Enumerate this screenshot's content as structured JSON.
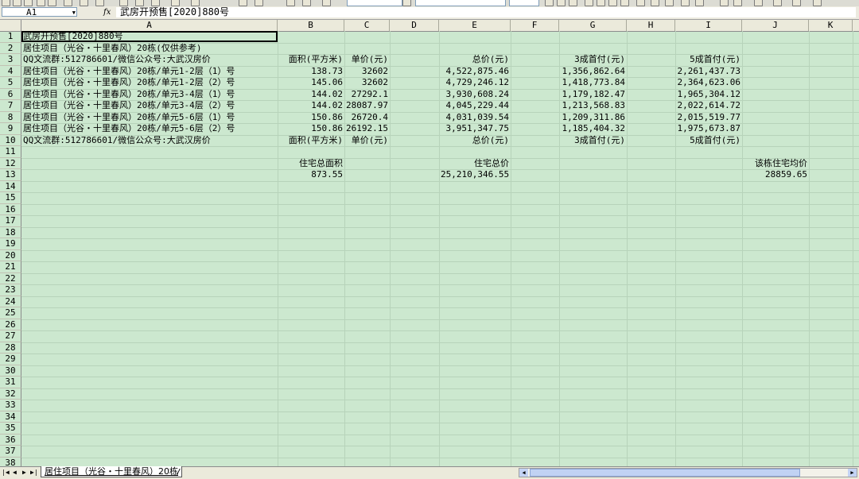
{
  "formula_bar": {
    "name_box": "A1",
    "fx_label": "fx",
    "formula": "武房开预售[2020]880号"
  },
  "columns": [
    "A",
    "B",
    "C",
    "D",
    "E",
    "F",
    "G",
    "H",
    "I",
    "J",
    "K"
  ],
  "rows": [
    "1",
    "2",
    "3",
    "4",
    "5",
    "6",
    "7",
    "8",
    "9",
    "10",
    "11",
    "12",
    "13",
    "14",
    "15",
    "16",
    "17",
    "18",
    "19",
    "20",
    "21",
    "22",
    "23",
    "24",
    "25",
    "26",
    "27",
    "28",
    "29",
    "30",
    "31",
    "32",
    "33",
    "34",
    "35",
    "36",
    "37",
    "38"
  ],
  "cells": {
    "r1": {
      "a": "武房开预售[2020]880号"
    },
    "r2": {
      "a": "居住项目（光谷・十里春风）20栋(仅供参考)"
    },
    "r3": {
      "a": "QQ文流群:512786601/微信公众号:大武汉房价",
      "b": "面积(平方米)",
      "c": "单价(元)",
      "e": "总价(元)",
      "g": "3成首付(元)",
      "i": "5成首付(元)"
    },
    "r4": {
      "a": "居住项目（光谷・十里春风）20栋/单元1-2层（1）号",
      "b": "138.73",
      "c": "32602",
      "e": "4,522,875.46",
      "g": "1,356,862.64",
      "i": "2,261,437.73"
    },
    "r5": {
      "a": "居住项目（光谷・十里春风）20栋/单元1-2层（2）号",
      "b": "145.06",
      "c": "32602",
      "e": "4,729,246.12",
      "g": "1,418,773.84",
      "i": "2,364,623.06"
    },
    "r6": {
      "a": "居住项目（光谷・十里春风）20栋/单元3-4层（1）号",
      "b": "144.02",
      "c": "27292.1",
      "e": "3,930,608.24",
      "g": "1,179,182.47",
      "i": "1,965,304.12"
    },
    "r7": {
      "a": "居住项目（光谷・十里春风）20栋/单元3-4层（2）号",
      "b": "144.02",
      "c": "28087.97",
      "e": "4,045,229.44",
      "g": "1,213,568.83",
      "i": "2,022,614.72"
    },
    "r8": {
      "a": "居住项目（光谷・十里春风）20栋/单元5-6层（1）号",
      "b": "150.86",
      "c": "26720.4",
      "e": "4,031,039.54",
      "g": "1,209,311.86",
      "i": "2,015,519.77"
    },
    "r9": {
      "a": "居住项目（光谷・十里春风）20栋/单元5-6层（2）号",
      "b": "150.86",
      "c": "26192.15",
      "e": "3,951,347.75",
      "g": "1,185,404.32",
      "i": "1,975,673.87"
    },
    "r10": {
      "a": "QQ文流群:512786601/微信公众号:大武汉房价",
      "b": "面积(平方米)",
      "c": "单价(元)",
      "e": "总价(元)",
      "g": "3成首付(元)",
      "i": "5成首付(元)"
    },
    "r12": {
      "b": "住宅总面积",
      "e": "住宅总价",
      "j": "该栋住宅均价"
    },
    "r13": {
      "b": "873.55",
      "e": "25,210,346.55",
      "j": "28859.65"
    }
  },
  "sheet_tab": "居住项目（光谷・十里春风）20栋",
  "tab_split": "/",
  "nav": {
    "first": "|◀",
    "prev": "◀",
    "next": "▶",
    "last": "▶|"
  },
  "colors": {
    "grid_bg": "#cce8cf",
    "header_bg": "#ebeadb"
  }
}
